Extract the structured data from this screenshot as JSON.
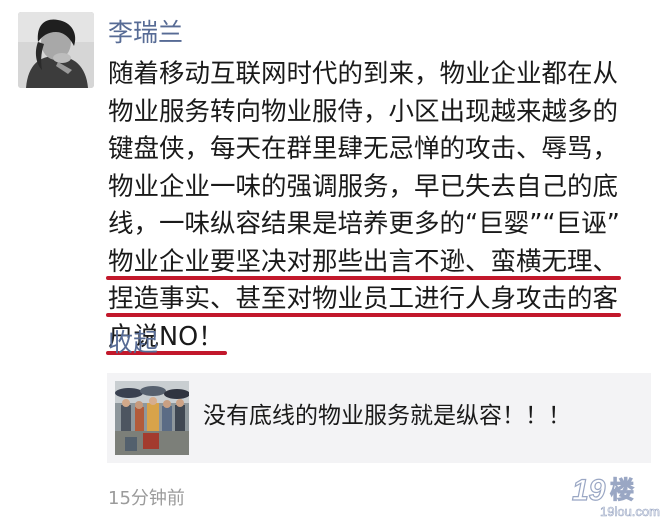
{
  "post": {
    "author": "李瑞兰",
    "lines": [
      "随着移动互联网时代的到来，物业企业都在从",
      "物业服务转向物业服侍，小区出现越来越多的",
      "键盘侠，每天在群里肆无忌惮的攻击、辱骂，",
      "物业企业一味的强调服务，早已失去自己的底",
      "线，一味纵容结果是培养更多的“巨婴”“巨诬”"
    ],
    "underlined_lines": [
      "物业企业要坚决对那些出言不逊、蛮横无理、",
      "捏造事实、甚至对物业员工进行人身攻击的客",
      "户说NO！"
    ],
    "collapse_label": "收起",
    "timestamp": "15分钟前"
  },
  "shared_article": {
    "title": "没有底线的物业服务就是纵容！！！"
  },
  "watermark": {
    "main": "19楼",
    "url": "19lou.com"
  },
  "colors": {
    "author_link": "#576b95",
    "underline": "#c2182b",
    "card_bg": "#f3f3f5",
    "timestamp": "#9b9b9b"
  }
}
